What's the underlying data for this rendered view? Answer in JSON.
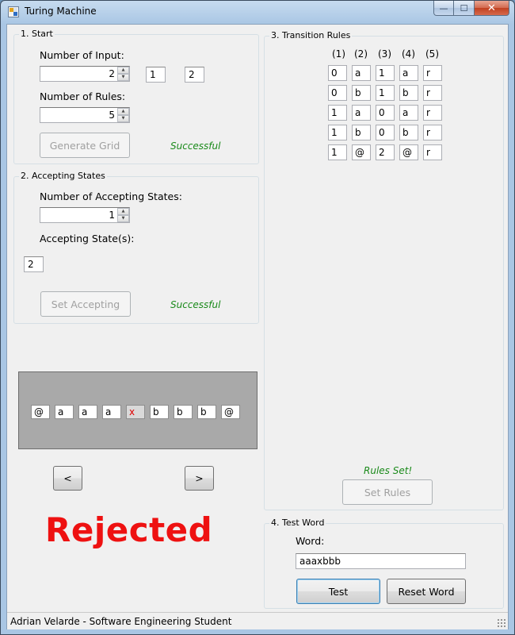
{
  "window": {
    "title": "Turing Machine",
    "controls": {
      "minimize": "—",
      "maximize": "☐",
      "close": "✕"
    }
  },
  "start": {
    "legend": "1. Start",
    "num_input_label": "Number of Input:",
    "num_input_value": "2",
    "input_box_1": "1",
    "input_box_2": "2",
    "num_rules_label": "Number of Rules:",
    "num_rules_value": "5",
    "generate_button": "Generate Grid",
    "status": "Successful"
  },
  "accepting": {
    "legend": "2. Accepting States",
    "num_label": "Number of Accepting States:",
    "num_value": "1",
    "states_label": "Accepting State(s):",
    "state_value": "2",
    "set_button": "Set Accepting",
    "status": "Successful"
  },
  "tape": {
    "cells": [
      "@",
      "a",
      "a",
      "a",
      "x",
      "b",
      "b",
      "b",
      "@"
    ],
    "head_index": 4,
    "left_button": "<",
    "right_button": ">"
  },
  "result": "Rejected",
  "rules": {
    "legend": "3. Transition Rules",
    "headers": [
      "(1)",
      "(2)",
      "(3)",
      "(4)",
      "(5)"
    ],
    "rows": [
      [
        "0",
        "a",
        "1",
        "a",
        "r"
      ],
      [
        "0",
        "b",
        "1",
        "b",
        "r"
      ],
      [
        "1",
        "a",
        "0",
        "a",
        "r"
      ],
      [
        "1",
        "b",
        "0",
        "b",
        "r"
      ],
      [
        "1",
        "@",
        "2",
        "@",
        "r"
      ]
    ],
    "status": "Rules Set!",
    "set_button": "Set Rules"
  },
  "test": {
    "legend": "4. Test Word",
    "word_label": "Word:",
    "word_value": "aaaxbbb",
    "test_button": "Test",
    "reset_button": "Reset Word"
  },
  "statusbar": {
    "text": "Adrian Velarde - Software Engineering Student"
  },
  "colors": {
    "success": "#1a8a1a",
    "rejected": "#ee1111",
    "tape_bg": "#a9a9a9"
  }
}
